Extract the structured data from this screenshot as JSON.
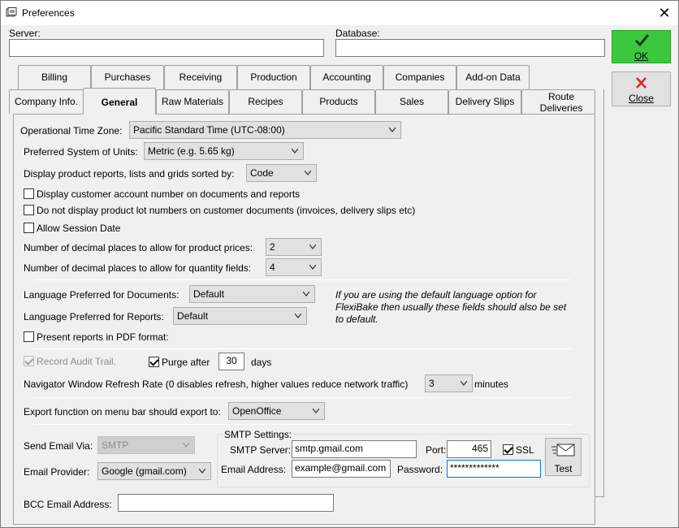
{
  "window": {
    "title": "Preferences",
    "close_glyph": "✕"
  },
  "top": {
    "server_label": "Server:",
    "server_value": "",
    "database_label": "Database:",
    "database_value": ""
  },
  "buttons": {
    "ok_label": "OK",
    "close_label": "Close",
    "test_label": "Test"
  },
  "tabs_row1": [
    "Billing",
    "Purchases",
    "Receiving",
    "Production",
    "Accounting",
    "Companies",
    "Add-on Data"
  ],
  "tabs_row2": [
    "Company Info.",
    "General",
    "Raw Materials",
    "Recipes",
    "Products",
    "Sales",
    "Delivery Slips",
    "Route Deliveries"
  ],
  "general": {
    "timezone_label": "Operational Time Zone:",
    "timezone_value": "Pacific Standard Time (UTC-08:00)",
    "units_label": "Preferred System of Units:",
    "units_value": "Metric (e.g. 5.65 kg)",
    "sort_label": "Display product reports, lists and grids sorted by:",
    "sort_value": "Code",
    "chk_customer_account": "Display customer account number on documents and reports",
    "chk_customer_account_checked": false,
    "chk_no_lot_numbers": "Do not display product lot numbers on customer documents (invoices, delivery slips etc)",
    "chk_no_lot_numbers_checked": false,
    "chk_session_date": "Allow Session Date",
    "chk_session_date_checked": false,
    "price_decimals_label": "Number of decimal places to allow for product prices:",
    "price_decimals_value": "2",
    "qty_decimals_label": "Number of decimal places to allow for quantity fields:",
    "qty_decimals_value": "4",
    "lang_docs_label": "Language Preferred for Documents:",
    "lang_docs_value": "Default",
    "lang_reports_label": "Language Preferred for Reports:",
    "lang_reports_value": "Default",
    "lang_note": "If you are using the default language option for FlexiBake then usually these fields should also be set to default.",
    "chk_pdf": "Present reports in PDF format:",
    "chk_pdf_checked": false,
    "chk_audit": "Record Audit Trail.",
    "chk_audit_checked": true,
    "chk_purge": "Purge after",
    "chk_purge_checked": true,
    "purge_days_value": "30",
    "purge_days_unit": "days",
    "refresh_label": "Navigator Window Refresh Rate (0 disables refresh, higher values reduce network traffic)",
    "refresh_value": "3",
    "refresh_unit": "minutes",
    "export_label": "Export function on menu bar should export to:",
    "export_value": "OpenOffice",
    "send_email_label": "Send Email Via:",
    "send_email_value": "SMTP",
    "email_provider_label": "Email Provider:",
    "email_provider_value": "Google (gmail.com)",
    "smtp_settings_label": "SMTP Settings:",
    "smtp_server_label": "SMTP Server:",
    "smtp_server_value": "smtp.gmail.com",
    "port_label": "Port:",
    "port_value": "465",
    "ssl_label": "SSL",
    "ssl_checked": true,
    "email_address_label": "Email Address:",
    "email_address_value": "example@gmail.com",
    "password_label": "Password:",
    "password_value": "*************",
    "bcc_label": "BCC Email Address:",
    "bcc_value": ""
  },
  "colors": {
    "ok_green": "#3cc83c",
    "close_red": "#d62828"
  }
}
